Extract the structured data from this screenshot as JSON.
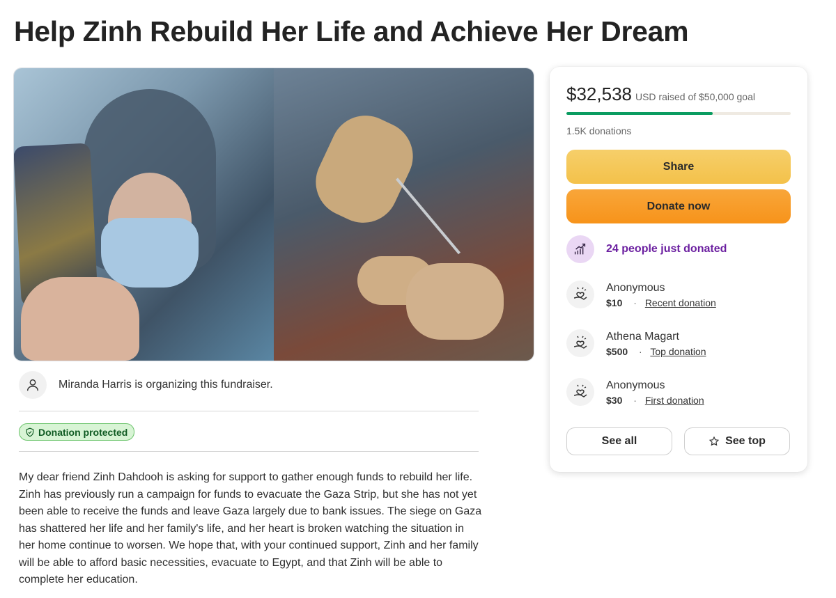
{
  "title": "Help Zinh Rebuild Her Life and Achieve Her Dream",
  "organizer": {
    "text": "Miranda Harris is organizing this fundraiser."
  },
  "badge": {
    "label": "Donation protected"
  },
  "story": "My dear friend Zinh Dahdooh is asking for support to gather enough funds to rebuild her life. Zinh has previously run a campaign for funds to evacuate the Gaza Strip, but she has not yet been able to receive the funds and leave Gaza largely due to bank issues. The siege on Gaza has shattered her life and her family's life, and her heart is broken watching the situation in her home continue to worsen. We hope that, with your continued support, Zinh and her family will be able to afford basic necessities, evacuate to Egypt, and that Zinh will be able to complete her education.",
  "card": {
    "raised_amount": "$32,538",
    "raised_rest": "USD raised of $50,000 goal",
    "progress_fraction": 0.651,
    "donations_count": "1.5K donations",
    "share_label": "Share",
    "donate_label": "Donate now",
    "recent_text": "24 people just donated",
    "donors": [
      {
        "name": "Anonymous",
        "amount": "$10",
        "tag": "Recent donation"
      },
      {
        "name": "Athena Magart",
        "amount": "$500",
        "tag": "Top donation"
      },
      {
        "name": "Anonymous",
        "amount": "$30",
        "tag": "First donation"
      }
    ],
    "see_all_label": "See all",
    "see_top_label": "See top"
  },
  "colors": {
    "progress": "#0a9c61",
    "share_button": "#f4c14a",
    "donate_button": "#f7931a",
    "recent_text": "#6b1fa0",
    "badge_bg": "#d8f4d5"
  },
  "icons": {
    "organizer": "person-icon",
    "badge": "shield-check-icon",
    "recent": "trending-up-icon",
    "donor": "heart-hand-icon",
    "see_top": "star-icon"
  }
}
